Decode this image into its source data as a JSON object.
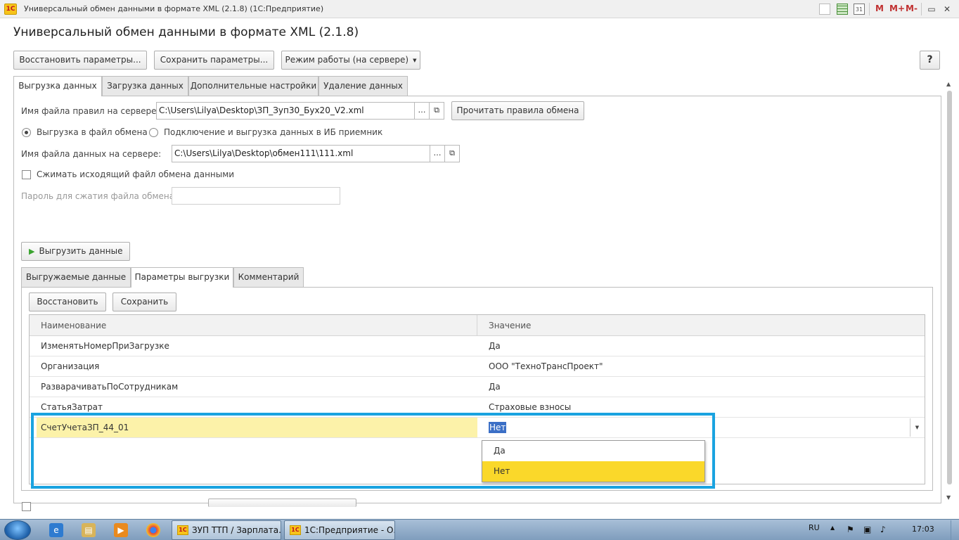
{
  "window": {
    "title": "Универсальный обмен данными в формате XML (2.1.8)  (1С:Предприятие)",
    "logo": "1С",
    "toolbar_icons": [
      "document-icon",
      "table-icon",
      "calendar-icon"
    ],
    "calendar_day": "31",
    "m_labels": [
      "M",
      "M+",
      "M-"
    ],
    "controls": {
      "restore": "▭",
      "close": "✕"
    }
  },
  "form": {
    "title": "Универсальный обмен данными в формате XML (2.1.8)",
    "buttons": {
      "restore_params": "Восстановить параметры...",
      "save_params": "Сохранить параметры...",
      "mode": "Режим работы (на сервере)",
      "help": "?"
    },
    "tabs": [
      "Выгрузка данных",
      "Загрузка данных",
      "Дополнительные настройки",
      "Удаление данных"
    ],
    "active_tab": 0,
    "rules_file": {
      "label": "Имя файла правил на сервере:",
      "value": "C:\\Users\\Lilya\\Desktop\\ЗП_Зуп30_Бух20_V2.xml",
      "read_button": "Прочитать правила обмена"
    },
    "radio": {
      "option1": "Выгрузка в файл обмена",
      "option2": "Подключение и выгрузка данных в ИБ приемник",
      "selected": 0
    },
    "data_file": {
      "label": "Имя файла данных на сервере:",
      "value": "C:\\Users\\Lilya\\Desktop\\обмен111\\111.xml"
    },
    "compress": {
      "label": "Сжимать исходящий файл обмена данными",
      "checked": false
    },
    "password": {
      "label": "Пароль для сжатия файла обмена:",
      "value": ""
    },
    "export_button": "Выгрузить данные",
    "inner_tabs": [
      "Выгружаемые данные",
      "Параметры выгрузки",
      "Комментарий"
    ],
    "inner_active_tab": 1,
    "params_toolbar": {
      "restore": "Восстановить",
      "save": "Сохранить"
    },
    "params_table": {
      "columns": [
        "Наименование",
        "Значение"
      ],
      "rows": [
        {
          "name": "ИзменятьНомерПриЗагрузке",
          "value": "Да"
        },
        {
          "name": "Организация",
          "value": "ООО \"ТехноТрансПроект\""
        },
        {
          "name": "РазварачиватьПоСотрудникам",
          "value": "Да"
        },
        {
          "name": "СтатьяЗатрат",
          "value": "Страховые взносы"
        },
        {
          "name": "СчетУчетаЗП_44_01",
          "value": "Нет"
        }
      ],
      "selected_row": 4
    },
    "dropdown": {
      "options": [
        "Да",
        "Нет"
      ],
      "highlighted": 1
    }
  },
  "taskbar": {
    "apps": [
      "ie-icon",
      "explorer-icon",
      "media-player-icon",
      "chrome-icon"
    ],
    "windows": [
      "ЗУП ТТП / Зарплата...",
      "1С:Предприятие - О..."
    ],
    "lang": "RU",
    "time": "17:03"
  },
  "colors": {
    "highlight_box": "#1aa3e0",
    "selected_row": "#fcf2a9",
    "dropdown_highlight": "#fad82a"
  }
}
